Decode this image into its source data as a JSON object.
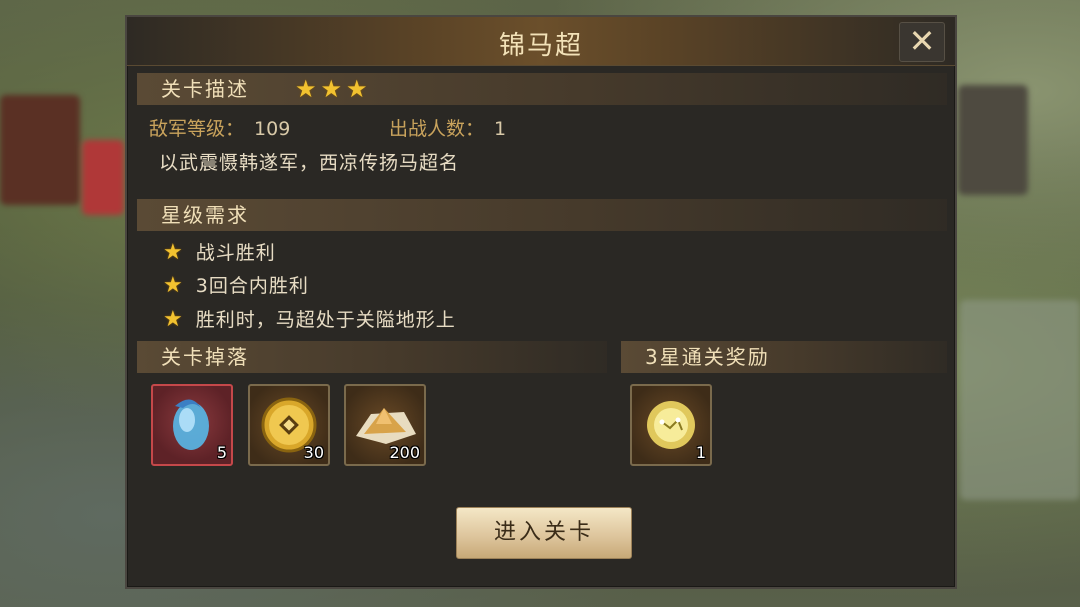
{
  "dialog": {
    "title": "锦马超",
    "close_icon": "close-x-icon"
  },
  "stage_desc": {
    "header": "关卡描述",
    "stars": 3,
    "enemy_level_label": "敌军等级：",
    "enemy_level_value": "109",
    "troop_count_label": "出战人数：",
    "troop_count_value": "1",
    "description": "以武震慑韩遂军，西凉传扬马超名"
  },
  "star_requirements": {
    "header": "星级需求",
    "items": [
      "战斗胜利",
      "3回合内胜利",
      "胜利时，马超处于关隘地形上"
    ]
  },
  "drops": {
    "header": "关卡掉落",
    "items": [
      {
        "icon": "blue-gem-icon",
        "qty": "5"
      },
      {
        "icon": "gold-coin-icon",
        "qty": "30"
      },
      {
        "icon": "sand-pile-icon",
        "qty": "200"
      }
    ]
  },
  "reward": {
    "header": "3星通关奖励",
    "items": [
      {
        "icon": "gold-orb-icon",
        "qty": "1"
      }
    ]
  },
  "enter_button": "进入关卡",
  "colors": {
    "gold_text": "#c9a35c",
    "star": "#f2c230",
    "panel": "#2a2824"
  }
}
